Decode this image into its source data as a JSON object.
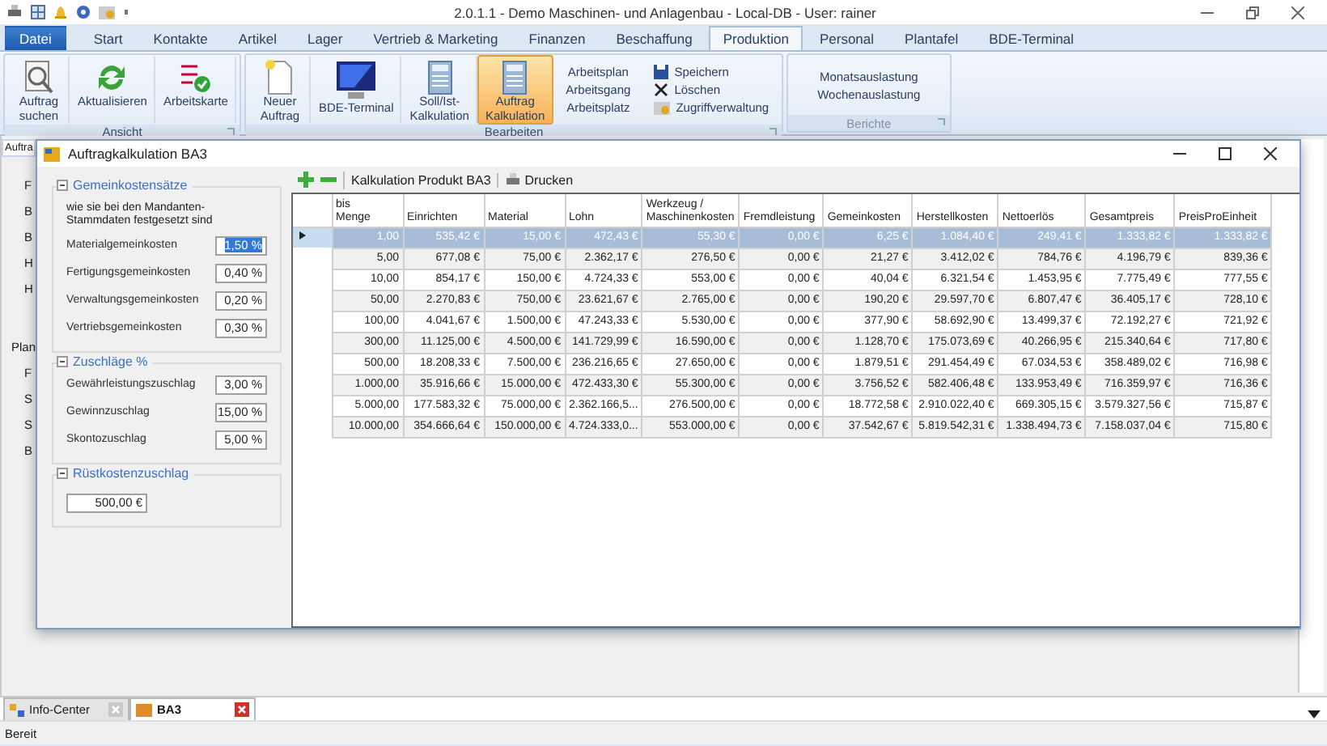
{
  "window": {
    "title": "2.0.1.1 - Demo Maschinen- und Anlagenbau - Local-DB - User: rainer"
  },
  "ribbon_tabs": [
    {
      "label": "Datei",
      "kind": "file",
      "selected": false
    },
    {
      "label": "Start",
      "kind": "tab",
      "selected": false
    },
    {
      "label": "Kontakte",
      "kind": "tab",
      "selected": false
    },
    {
      "label": "Artikel",
      "kind": "tab",
      "selected": false
    },
    {
      "label": "Lager",
      "kind": "tab",
      "selected": false
    },
    {
      "label": "Vertrieb & Marketing",
      "kind": "tab",
      "selected": false
    },
    {
      "label": "Finanzen",
      "kind": "tab",
      "selected": false
    },
    {
      "label": "Beschaffung",
      "kind": "tab",
      "selected": false
    },
    {
      "label": "Produktion",
      "kind": "tab",
      "selected": true
    },
    {
      "label": "Personal",
      "kind": "tab",
      "selected": false
    },
    {
      "label": "Plantafel",
      "kind": "tab",
      "selected": false
    },
    {
      "label": "BDE-Terminal",
      "kind": "tab",
      "selected": false
    }
  ],
  "ribbon_groups": [
    {
      "label": "Ansicht",
      "disabled": false,
      "large_buttons": [
        {
          "label": "Auftrag\nsuchen",
          "selected": false
        },
        {
          "label": "Aktualisieren",
          "selected": false
        },
        {
          "label": "Arbeitskarte",
          "selected": false
        }
      ]
    },
    {
      "label": "Bearbeiten",
      "disabled": false,
      "large_buttons": [
        {
          "label": "Neuer\nAuftrag",
          "selected": false
        },
        {
          "label": "BDE-Terminal",
          "selected": false
        },
        {
          "label": "Soll/Ist-\nKalkulation",
          "selected": false
        },
        {
          "label": "Auftrag\nKalkulation",
          "selected": true
        }
      ],
      "link_buttons": [
        "Arbeitsplan",
        "Arbeitsgang",
        "Arbeitsplatz"
      ],
      "small_buttons": [
        "Speichern",
        "Löschen",
        "Zugriffverwaltung"
      ]
    },
    {
      "label": "Berichte",
      "disabled": true,
      "link_buttons": [
        "Monatsauslastung",
        "Wochenauslastung"
      ]
    }
  ],
  "background_form": {
    "tab": "Auftra",
    "labels_top": [
      "F",
      "B",
      "B",
      "H",
      "H"
    ],
    "section": "Plan",
    "labels_bottom": [
      "F",
      "S",
      "S",
      "B"
    ]
  },
  "dialog": {
    "title": "Auftragkalkulation BA3",
    "groups": [
      {
        "title": "Gemeinkostensätze",
        "note": "wie sie bei den Mandanten-\nStammdaten festgesetzt sind",
        "fields": [
          {
            "label": "Materialgemeinkosten",
            "value": "1,50 %",
            "selected": true
          },
          {
            "label": "Fertigungsgemeinkosten",
            "value": "0,40 %",
            "selected": false
          },
          {
            "label": "Verwaltungsgemeinkosten",
            "value": "0,20 %",
            "selected": false
          },
          {
            "label": "Vertriebsgemeinkosten",
            "value": "0,30 %",
            "selected": false
          }
        ]
      },
      {
        "title": "Zuschläge %",
        "fields": [
          {
            "label": "Gewährleistungszuschlag",
            "value": "3,00 %",
            "selected": false
          },
          {
            "label": "Gewinnzuschlag",
            "value": "15,00 %",
            "selected": false
          },
          {
            "label": "Skontozuschlag",
            "value": "5,00 %",
            "selected": false
          }
        ]
      },
      {
        "title": "Rüstkostenzuschlag",
        "fields": [
          {
            "value": "500,00 €",
            "selected": false
          }
        ]
      }
    ],
    "toolbar": {
      "label": "Kalkulation Produkt BA3",
      "print": "Drucken"
    },
    "table": {
      "columns": [
        "bis\nMenge",
        "Einrichten",
        "Material",
        "Lohn",
        "Werkzeug /\nMaschinenkosten",
        "Fremdleistung",
        "Gemeinkosten",
        "Herstellkosten",
        "Nettoerlös",
        "Gesamtpreis",
        "PreisProEinheit"
      ],
      "rows": [
        {
          "selected": true,
          "cells": [
            "1,00",
            "535,42 €",
            "15,00 €",
            "472,43 €",
            "55,30 €",
            "0,00 €",
            "6,25 €",
            "1.084,40 €",
            "249,41 €",
            "1.333,82 €",
            "1.333,82 €"
          ]
        },
        {
          "selected": false,
          "cells": [
            "5,00",
            "677,08 €",
            "75,00 €",
            "2.362,17 €",
            "276,50 €",
            "0,00 €",
            "21,27 €",
            "3.412,02 €",
            "784,76 €",
            "4.196,79 €",
            "839,36 €"
          ]
        },
        {
          "selected": false,
          "cells": [
            "10,00",
            "854,17 €",
            "150,00 €",
            "4.724,33 €",
            "553,00 €",
            "0,00 €",
            "40,04 €",
            "6.321,54 €",
            "1.453,95 €",
            "7.775,49 €",
            "777,55 €"
          ]
        },
        {
          "selected": false,
          "cells": [
            "50,00",
            "2.270,83 €",
            "750,00 €",
            "23.621,67 €",
            "2.765,00 €",
            "0,00 €",
            "190,20 €",
            "29.597,70 €",
            "6.807,47 €",
            "36.405,17 €",
            "728,10 €"
          ]
        },
        {
          "selected": false,
          "cells": [
            "100,00",
            "4.041,67 €",
            "1.500,00 €",
            "47.243,33 €",
            "5.530,00 €",
            "0,00 €",
            "377,90 €",
            "58.692,90 €",
            "13.499,37 €",
            "72.192,27 €",
            "721,92 €"
          ]
        },
        {
          "selected": false,
          "cells": [
            "300,00",
            "11.125,00 €",
            "4.500,00 €",
            "141.729,99 €",
            "16.590,00 €",
            "0,00 €",
            "1.128,70 €",
            "175.073,69 €",
            "40.266,95 €",
            "215.340,64 €",
            "717,80 €"
          ]
        },
        {
          "selected": false,
          "cells": [
            "500,00",
            "18.208,33 €",
            "7.500,00 €",
            "236.216,65 €",
            "27.650,00 €",
            "0,00 €",
            "1.879,51 €",
            "291.454,49 €",
            "67.034,53 €",
            "358.489,02 €",
            "716,98 €"
          ]
        },
        {
          "selected": false,
          "cells": [
            "1.000,00",
            "35.916,66 €",
            "15.000,00 €",
            "472.433,30 €",
            "55.300,00 €",
            "0,00 €",
            "3.756,52 €",
            "582.406,48 €",
            "133.953,49 €",
            "716.359,97 €",
            "716,36 €"
          ]
        },
        {
          "selected": false,
          "cells": [
            "5.000,00",
            "177.583,32 €",
            "75.000,00 €",
            "2.362.166,5...",
            "276.500,00 €",
            "0,00 €",
            "18.772,58 €",
            "2.910.022,40 €",
            "669.305,15 €",
            "3.579.327,56 €",
            "715,87 €"
          ]
        },
        {
          "selected": false,
          "cells": [
            "10.000,00",
            "354.666,64 €",
            "150.000,00 €",
            "4.724.333,0...",
            "553.000,00 €",
            "0,00 €",
            "37.542,67 €",
            "5.819.542,31 €",
            "1.338.494,73 €",
            "7.158.037,04 €",
            "715,80 €"
          ]
        }
      ]
    }
  },
  "document_tabs": [
    {
      "label": "Info-Center",
      "selected": false
    },
    {
      "label": "BA3",
      "selected": true
    }
  ],
  "status_bar": {
    "text": "Bereit"
  }
}
